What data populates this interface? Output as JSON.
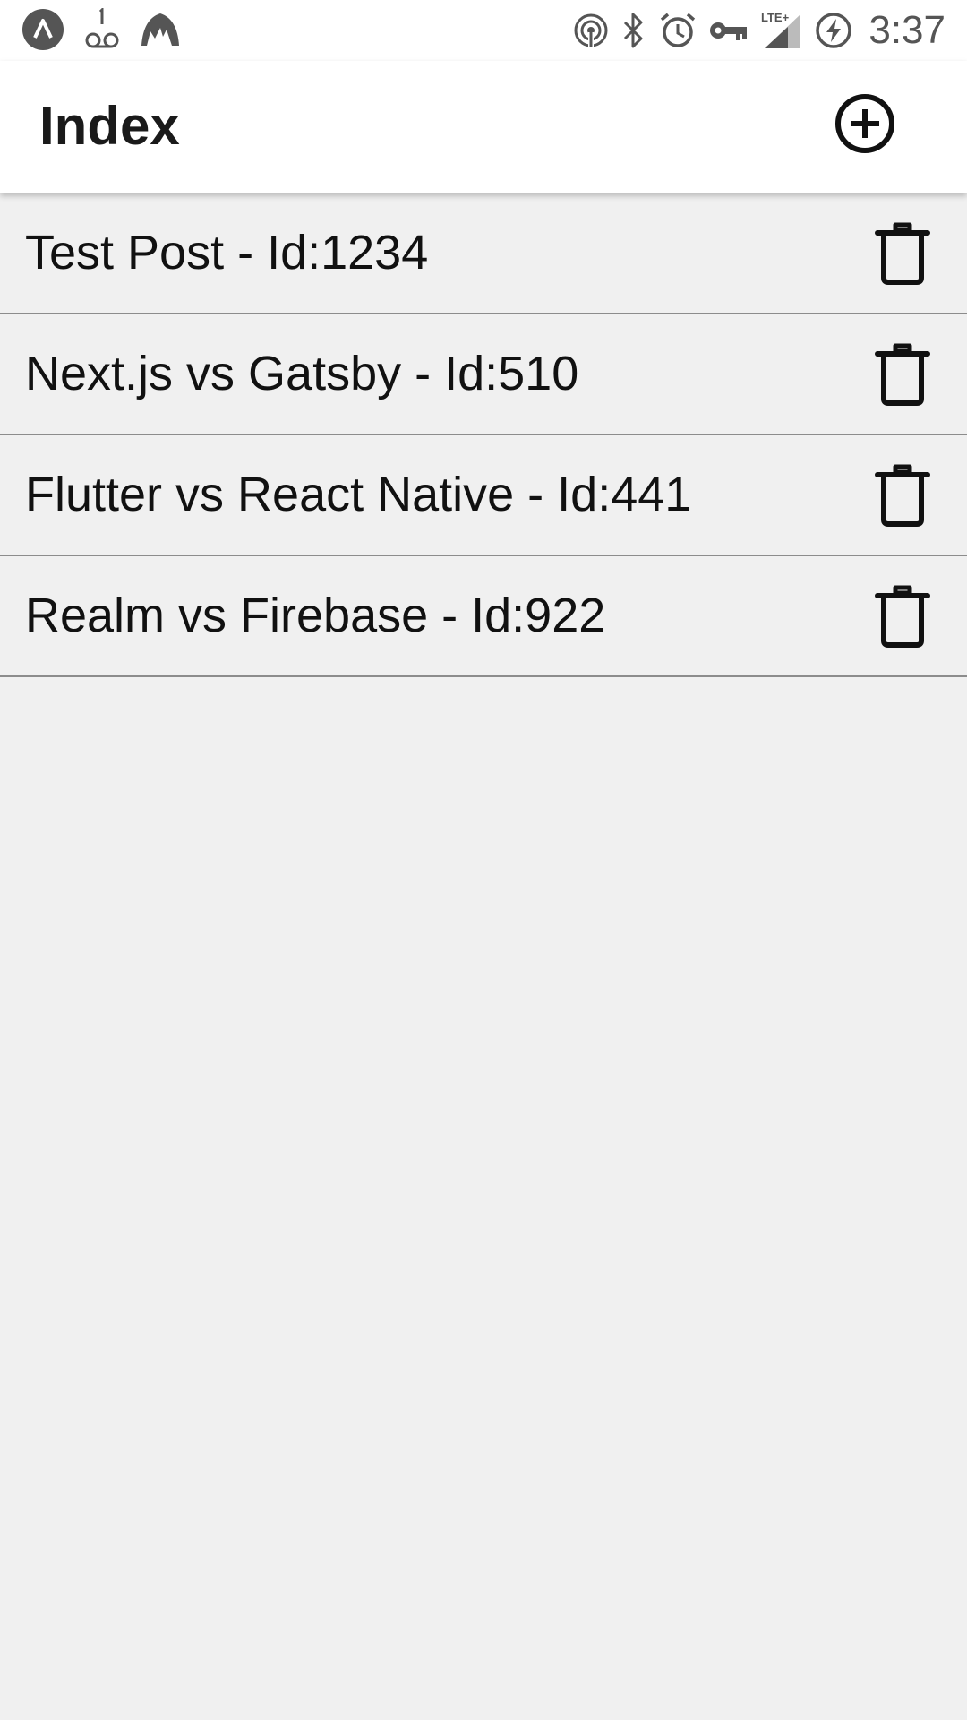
{
  "status_bar": {
    "time": "3:37",
    "left_icons": [
      "app-logo-icon",
      "voicemail-icon",
      "mountain-icon"
    ],
    "right_icons": [
      "hotspot-icon",
      "bluetooth-icon",
      "alarm-icon",
      "vpn-key-icon",
      "lte-signal-icon",
      "battery-charging-icon"
    ],
    "network_label": "LTE+"
  },
  "app_bar": {
    "title": "Index",
    "add_icon": "add-circle-icon"
  },
  "posts": [
    {
      "label": "Test Post - Id:1234",
      "delete_icon": "trash-icon"
    },
    {
      "label": "Next.js vs Gatsby - Id:510",
      "delete_icon": "trash-icon"
    },
    {
      "label": "Flutter vs React Native - Id:441",
      "delete_icon": "trash-icon"
    },
    {
      "label": "Realm vs Firebase - Id:922",
      "delete_icon": "trash-icon"
    }
  ],
  "colors": {
    "background": "#f0f0f0",
    "app_bar": "#ffffff",
    "divider": "#8c8c8c",
    "text": "#111111",
    "status_icons": "#555555"
  }
}
